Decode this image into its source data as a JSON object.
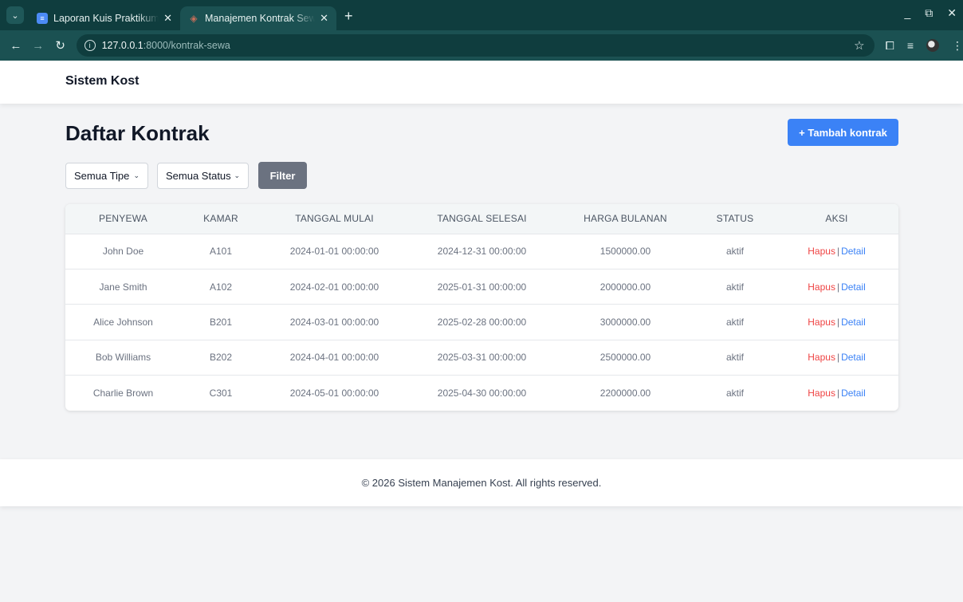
{
  "browser": {
    "tabs": [
      {
        "title": "Laporan Kuis Praktikum P",
        "icon": "docs-icon",
        "active": false
      },
      {
        "title": "Manajemen Kontrak Sewa",
        "icon": "laravel-icon",
        "active": true
      }
    ],
    "url_host": "127.0.0.1",
    "url_rest": ":8000/kontrak-sewa"
  },
  "app": {
    "brand": "Sistem Kost"
  },
  "page": {
    "title": "Daftar Kontrak",
    "add_button": "+ Tambah kontrak",
    "filter_type": "Semua Tipe",
    "filter_status": "Semua Status",
    "filter_button": "Filter"
  },
  "table": {
    "headers": [
      "PENYEWA",
      "KAMAR",
      "TANGGAL MULAI",
      "TANGGAL SELESAI",
      "HARGA BULANAN",
      "STATUS",
      "AKSI"
    ],
    "action_delete": "Hapus",
    "action_separator": "|",
    "action_detail": "Detail",
    "rows": [
      {
        "penyewa": "John Doe",
        "kamar": "A101",
        "mulai": "2024-01-01 00:00:00",
        "selesai": "2024-12-31 00:00:00",
        "harga": "1500000.00",
        "status": "aktif"
      },
      {
        "penyewa": "Jane Smith",
        "kamar": "A102",
        "mulai": "2024-02-01 00:00:00",
        "selesai": "2025-01-31 00:00:00",
        "harga": "2000000.00",
        "status": "aktif"
      },
      {
        "penyewa": "Alice Johnson",
        "kamar": "B201",
        "mulai": "2024-03-01 00:00:00",
        "selesai": "2025-02-28 00:00:00",
        "harga": "3000000.00",
        "status": "aktif"
      },
      {
        "penyewa": "Bob Williams",
        "kamar": "B202",
        "mulai": "2024-04-01 00:00:00",
        "selesai": "2025-03-31 00:00:00",
        "harga": "2500000.00",
        "status": "aktif"
      },
      {
        "penyewa": "Charlie Brown",
        "kamar": "C301",
        "mulai": "2024-05-01 00:00:00",
        "selesai": "2025-04-30 00:00:00",
        "harga": "2200000.00",
        "status": "aktif"
      }
    ]
  },
  "footer": {
    "text": "© 2026 Sistem Manajemen Kost. All rights reserved."
  }
}
